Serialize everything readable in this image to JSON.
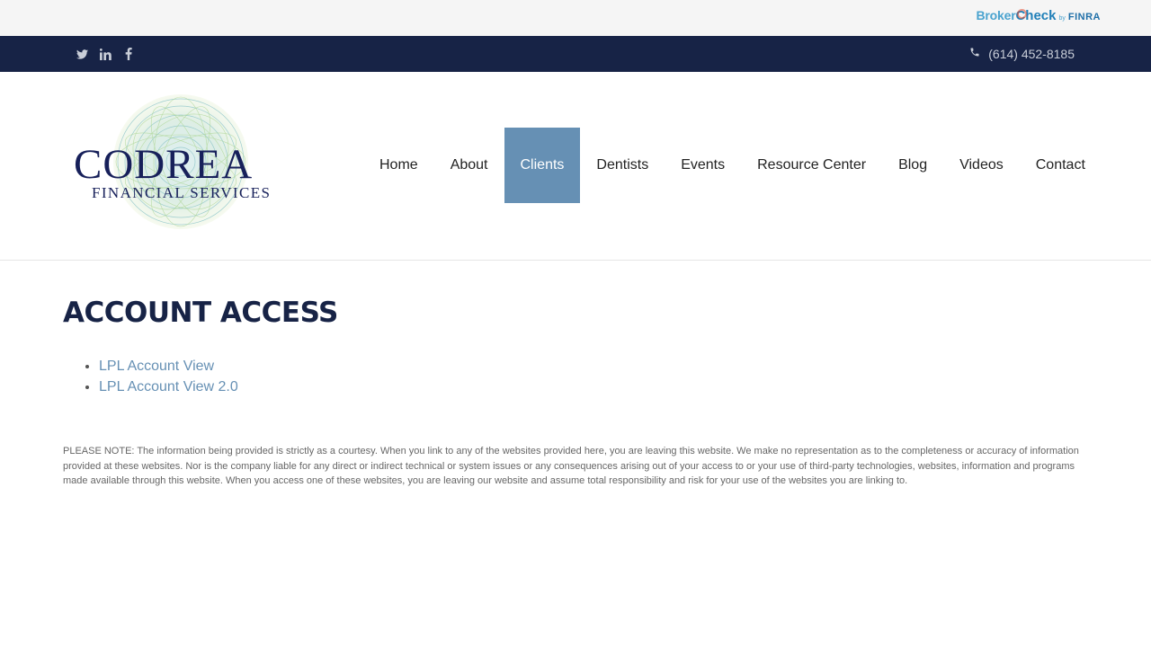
{
  "topbar": {
    "brokercheck": {
      "broker": "Broker",
      "check": "Check",
      "by": "by",
      "finra": "FINRA"
    }
  },
  "utility_bar": {
    "social": [
      "twitter-icon",
      "linkedin-icon",
      "facebook-icon"
    ],
    "phone": "(614) 452-8185"
  },
  "logo": {
    "name": "CODREA",
    "tagline": "FINANCIAL SERVICES"
  },
  "nav": {
    "items": [
      {
        "label": "Home"
      },
      {
        "label": "About"
      },
      {
        "label": "Clients"
      },
      {
        "label": "Dentists"
      },
      {
        "label": "Events"
      },
      {
        "label": "Resource Center"
      },
      {
        "label": "Blog"
      },
      {
        "label": "Videos"
      },
      {
        "label": "Contact"
      }
    ],
    "active": "Clients"
  },
  "main": {
    "title": "ACCOUNT ACCESS",
    "links": [
      {
        "label": "LPL Account View"
      },
      {
        "label": "LPL Account View 2.0"
      }
    ],
    "disclaimer": "PLEASE NOTE: The information being provided is strictly as a courtesy. When you link to any of the websites provided here, you are leaving this website. We make no representation as to the completeness or accuracy of information provided at these websites. Nor is the company liable for any direct or indirect technical or system issues or any consequences arising out of your access to or your use of third-party technologies, websites, information and programs made available through this website. When you access one of these websites, you are leaving our website and assume total responsibility and risk for your use of the websites you are linking to."
  },
  "colors": {
    "navy": "#172346",
    "nav_active": "#6690b4",
    "link": "#6690b4",
    "topbar_bg": "#f5f5f5"
  }
}
